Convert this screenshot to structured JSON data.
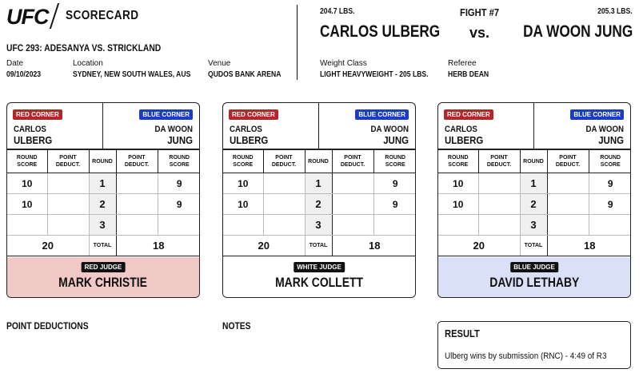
{
  "header": {
    "brand": "UFC",
    "title": "SCORECARD",
    "event": "UFC 293: ADESANYA VS. STRICKLAND",
    "date_label": "Date",
    "date": "09/10/2023",
    "location_label": "Location",
    "location": "SYDNEY, NEW SOUTH WALES, AUS",
    "venue_label": "Venue",
    "venue": "QUDOS BANK ARENA",
    "weight_class_label": "Weight Class",
    "weight_class": "LIGHT HEAVYWEIGHT - 205 LBS.",
    "referee_label": "Referee",
    "referee": "HERB DEAN"
  },
  "bout": {
    "fight_number": "FIGHT #7",
    "red_weight": "204.7 LBS.",
    "blue_weight": "205.3 LBS.",
    "red_name": "CARLOS ULBERG",
    "vs": "vs.",
    "blue_name": "DA WOON JUNG"
  },
  "labels": {
    "red_corner": "RED CORNER",
    "blue_corner": "BLUE CORNER",
    "round_score_1": "ROUND",
    "round_score_2": "SCORE",
    "point_deduct_1": "POINT",
    "point_deduct_2": "DEDUCT.",
    "round": "ROUND",
    "total": "TOTAL",
    "red_first": "CARLOS",
    "red_last": "ULBERG",
    "blue_first": "DA WOON",
    "blue_last": "JUNG"
  },
  "cards": [
    {
      "judge_badge": "RED JUDGE",
      "judge_name": "MARK CHRISTIE",
      "judge_bg": "#f0c8c6",
      "rounds": [
        {
          "red": "10",
          "red_ded": "",
          "num": "1",
          "blue_ded": "",
          "blue": "9"
        },
        {
          "red": "10",
          "red_ded": "",
          "num": "2",
          "blue_ded": "",
          "blue": "9"
        },
        {
          "red": "",
          "red_ded": "",
          "num": "3",
          "blue_ded": "",
          "blue": ""
        }
      ],
      "red_total": "20",
      "blue_total": "18"
    },
    {
      "judge_badge": "WHITE JUDGE",
      "judge_name": "MARK COLLETT",
      "judge_bg": "#ffffff",
      "rounds": [
        {
          "red": "10",
          "red_ded": "",
          "num": "1",
          "blue_ded": "",
          "blue": "9"
        },
        {
          "red": "10",
          "red_ded": "",
          "num": "2",
          "blue_ded": "",
          "blue": "9"
        },
        {
          "red": "",
          "red_ded": "",
          "num": "3",
          "blue_ded": "",
          "blue": ""
        }
      ],
      "red_total": "20",
      "blue_total": "18"
    },
    {
      "judge_badge": "BLUE JUDGE",
      "judge_name": "DAVID LETHABY",
      "judge_bg": "#d9e0f7",
      "rounds": [
        {
          "red": "10",
          "red_ded": "",
          "num": "1",
          "blue_ded": "",
          "blue": "9"
        },
        {
          "red": "10",
          "red_ded": "",
          "num": "2",
          "blue_ded": "",
          "blue": "9"
        },
        {
          "red": "",
          "red_ded": "",
          "num": "3",
          "blue_ded": "",
          "blue": ""
        }
      ],
      "red_total": "20",
      "blue_total": "18"
    }
  ],
  "footer": {
    "point_deductions": "POINT DEDUCTIONS",
    "notes": "NOTES",
    "result_title": "RESULT",
    "result_text": "Ulberg wins by submission (RNC) - 4:49 of R3"
  },
  "colors": {
    "red_corner": "#b5262b",
    "blue_corner": "#1a3cc8"
  }
}
